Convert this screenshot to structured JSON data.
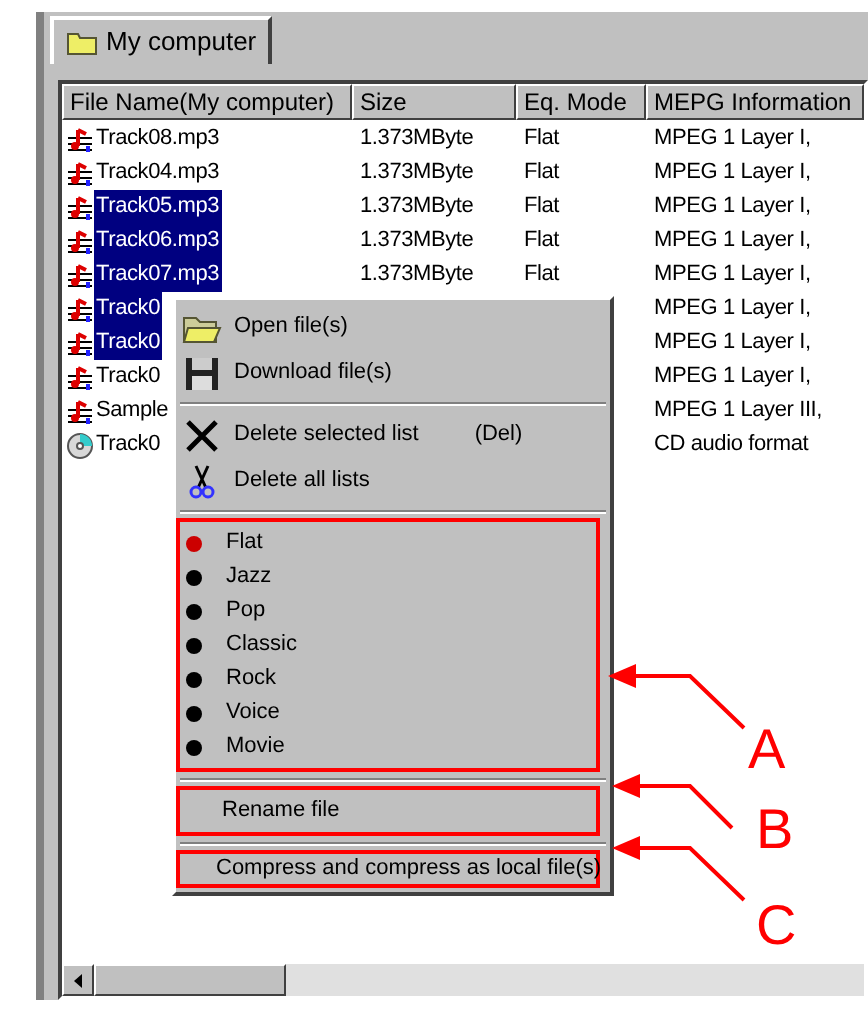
{
  "tab": {
    "label": "My computer",
    "selected": true
  },
  "table": {
    "columns": [
      "File Name(My computer)",
      "Size",
      "Eq. Mode",
      "MEPG Information"
    ],
    "rows": [
      {
        "kind": "mp3",
        "selected": false,
        "cells": [
          "Track08.mp3",
          "1.373MByte",
          "Flat",
          "MPEG 1 Layer I,"
        ]
      },
      {
        "kind": "mp3",
        "selected": false,
        "cells": [
          "Track04.mp3",
          "1.373MByte",
          "Flat",
          "MPEG 1 Layer I,"
        ]
      },
      {
        "kind": "mp3",
        "selected": true,
        "cells": [
          "Track05.mp3",
          "1.373MByte",
          "Flat",
          "MPEG 1 Layer I,"
        ]
      },
      {
        "kind": "mp3",
        "selected": true,
        "cells": [
          "Track06.mp3",
          "1.373MByte",
          "Flat",
          "MPEG 1 Layer I,"
        ]
      },
      {
        "kind": "mp3",
        "selected": true,
        "cells": [
          "Track07.mp3",
          "1.373MByte",
          "Flat",
          "MPEG 1 Layer I,"
        ]
      },
      {
        "kind": "mp3",
        "selected": true,
        "cells": [
          "Track0",
          null,
          null,
          "MPEG 1 Layer I,"
        ]
      },
      {
        "kind": "mp3",
        "selected": true,
        "cells": [
          "Track0",
          null,
          null,
          "MPEG 1 Layer I,"
        ]
      },
      {
        "kind": "mp3",
        "selected": false,
        "cells": [
          "Track0",
          null,
          null,
          "MPEG 1 Layer I,"
        ]
      },
      {
        "kind": "mp3",
        "selected": false,
        "cells": [
          "Sample",
          null,
          null,
          "MPEG 1 Layer III,"
        ]
      },
      {
        "kind": "cd",
        "selected": false,
        "cells": [
          "Track0",
          null,
          null,
          "CD audio format"
        ]
      }
    ]
  },
  "context_menu": {
    "commands": [
      {
        "kind": "open",
        "label": "Open file(s)"
      },
      {
        "kind": "download",
        "label": "Download file(s)"
      }
    ],
    "delete_commands": [
      {
        "kind": "delete",
        "label": "Delete selected list",
        "shortcut": "(Del)"
      },
      {
        "kind": "clear",
        "label": "Delete all lists"
      }
    ],
    "eq_modes": [
      {
        "label": "Flat",
        "selected": true
      },
      {
        "label": "Jazz",
        "selected": false
      },
      {
        "label": "Pop",
        "selected": false
      },
      {
        "label": "Classic",
        "selected": false
      },
      {
        "label": "Rock",
        "selected": false
      },
      {
        "label": "Voice",
        "selected": false
      },
      {
        "label": "Movie",
        "selected": false
      }
    ],
    "rename": {
      "label": "Rename file"
    },
    "compress": {
      "label": "Compress and compress as local file(s)"
    }
  },
  "callouts": [
    {
      "label": "A"
    },
    {
      "label": "B"
    },
    {
      "label": "C"
    }
  ]
}
